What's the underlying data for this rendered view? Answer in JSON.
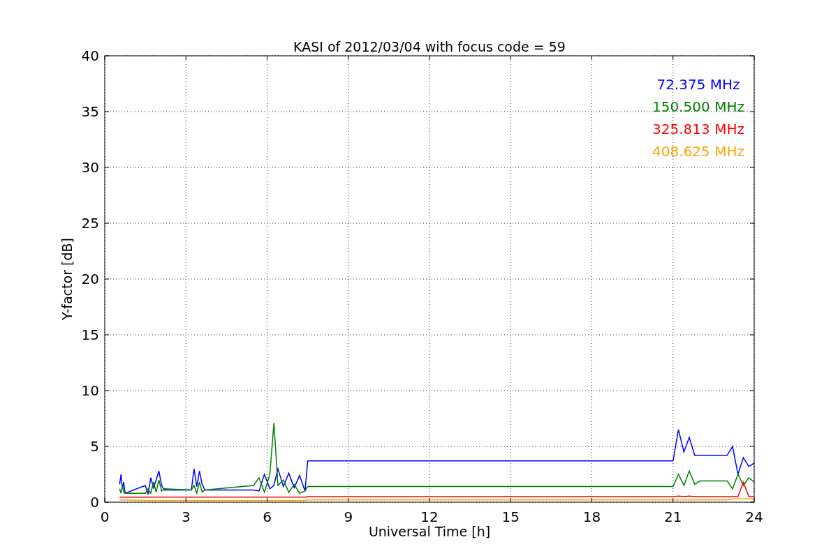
{
  "chart_data": {
    "type": "line",
    "title": "KASI of 2012/03/04 with focus code = 59",
    "xlabel": "Universal Time [h]",
    "ylabel": "Y-factor [dB]",
    "x": [
      0.55,
      0.6,
      0.65,
      0.7,
      0.75,
      1.5,
      1.6,
      1.7,
      1.8,
      1.9,
      2.0,
      2.1,
      2.2,
      3.2,
      3.3,
      3.4,
      3.5,
      3.6,
      3.7,
      5.5,
      5.7,
      5.9,
      6.1,
      6.25,
      6.4,
      6.6,
      6.8,
      7.0,
      7.2,
      7.4,
      7.5,
      21.0,
      21.2,
      21.4,
      21.6,
      21.8,
      22.0,
      23.0,
      23.2,
      23.4,
      23.6,
      23.8,
      24.0
    ],
    "series": [
      {
        "name": "72.375 MHz",
        "color": "#0000ff",
        "values": [
          1.6,
          2.5,
          1.2,
          1.8,
          0.8,
          1.5,
          0.7,
          2.2,
          1.3,
          2.0,
          2.8,
          1.5,
          1.1,
          1.1,
          3.0,
          1.4,
          2.8,
          1.6,
          1.1,
          1.1,
          1.0,
          2.5,
          1.2,
          1.5,
          3.0,
          1.4,
          2.6,
          1.3,
          2.4,
          1.0,
          3.7,
          3.7,
          6.5,
          4.5,
          5.8,
          4.2,
          4.2,
          4.2,
          5.0,
          2.5,
          4.0,
          3.2,
          3.5
        ]
      },
      {
        "name": "150.500 MHz",
        "color": "#008000",
        "values": [
          1.2,
          0.8,
          1.5,
          0.9,
          0.8,
          0.8,
          1.2,
          0.8,
          1.8,
          0.9,
          2.0,
          1.0,
          1.2,
          1.1,
          1.5,
          0.8,
          1.8,
          0.9,
          1.1,
          1.5,
          2.2,
          0.9,
          2.5,
          7.1,
          1.5,
          2.0,
          0.9,
          1.6,
          0.8,
          1.0,
          1.4,
          1.4,
          2.5,
          1.5,
          2.8,
          1.6,
          1.9,
          1.9,
          1.2,
          2.5,
          1.5,
          2.2,
          1.8
        ]
      },
      {
        "name": "325.813 MHz",
        "color": "#ff0000",
        "values": [
          0.45,
          0.45,
          0.45,
          0.45,
          0.45,
          0.45,
          0.45,
          0.45,
          0.45,
          0.45,
          0.45,
          0.45,
          0.45,
          0.45,
          0.45,
          0.45,
          0.45,
          0.45,
          0.45,
          0.45,
          0.45,
          0.45,
          0.45,
          0.45,
          0.45,
          0.45,
          0.45,
          0.45,
          0.45,
          0.45,
          0.5,
          0.5,
          0.55,
          0.5,
          0.55,
          0.5,
          0.5,
          0.5,
          0.5,
          0.5,
          1.8,
          0.5,
          0.5
        ]
      },
      {
        "name": "408.625 MHz",
        "color": "#ffa500",
        "values": [
          0.2,
          0.2,
          0.2,
          0.2,
          0.2,
          0.15,
          0.15,
          0.15,
          0.15,
          0.15,
          0.15,
          0.15,
          0.15,
          0.15,
          0.15,
          0.15,
          0.15,
          0.15,
          0.15,
          0.15,
          0.15,
          0.15,
          0.15,
          0.15,
          0.15,
          0.15,
          0.15,
          0.15,
          0.15,
          0.15,
          0.2,
          0.2,
          0.2,
          0.2,
          0.2,
          0.2,
          0.2,
          0.2,
          0.3,
          0.3,
          0.3,
          0.3,
          0.3
        ]
      }
    ],
    "xlim": [
      0,
      24
    ],
    "ylim": [
      0,
      40
    ],
    "xticks": [
      0,
      3,
      6,
      9,
      12,
      15,
      18,
      21,
      24
    ],
    "yticks": [
      0,
      5,
      10,
      15,
      20,
      25,
      30,
      35,
      40
    ],
    "grid": true
  }
}
